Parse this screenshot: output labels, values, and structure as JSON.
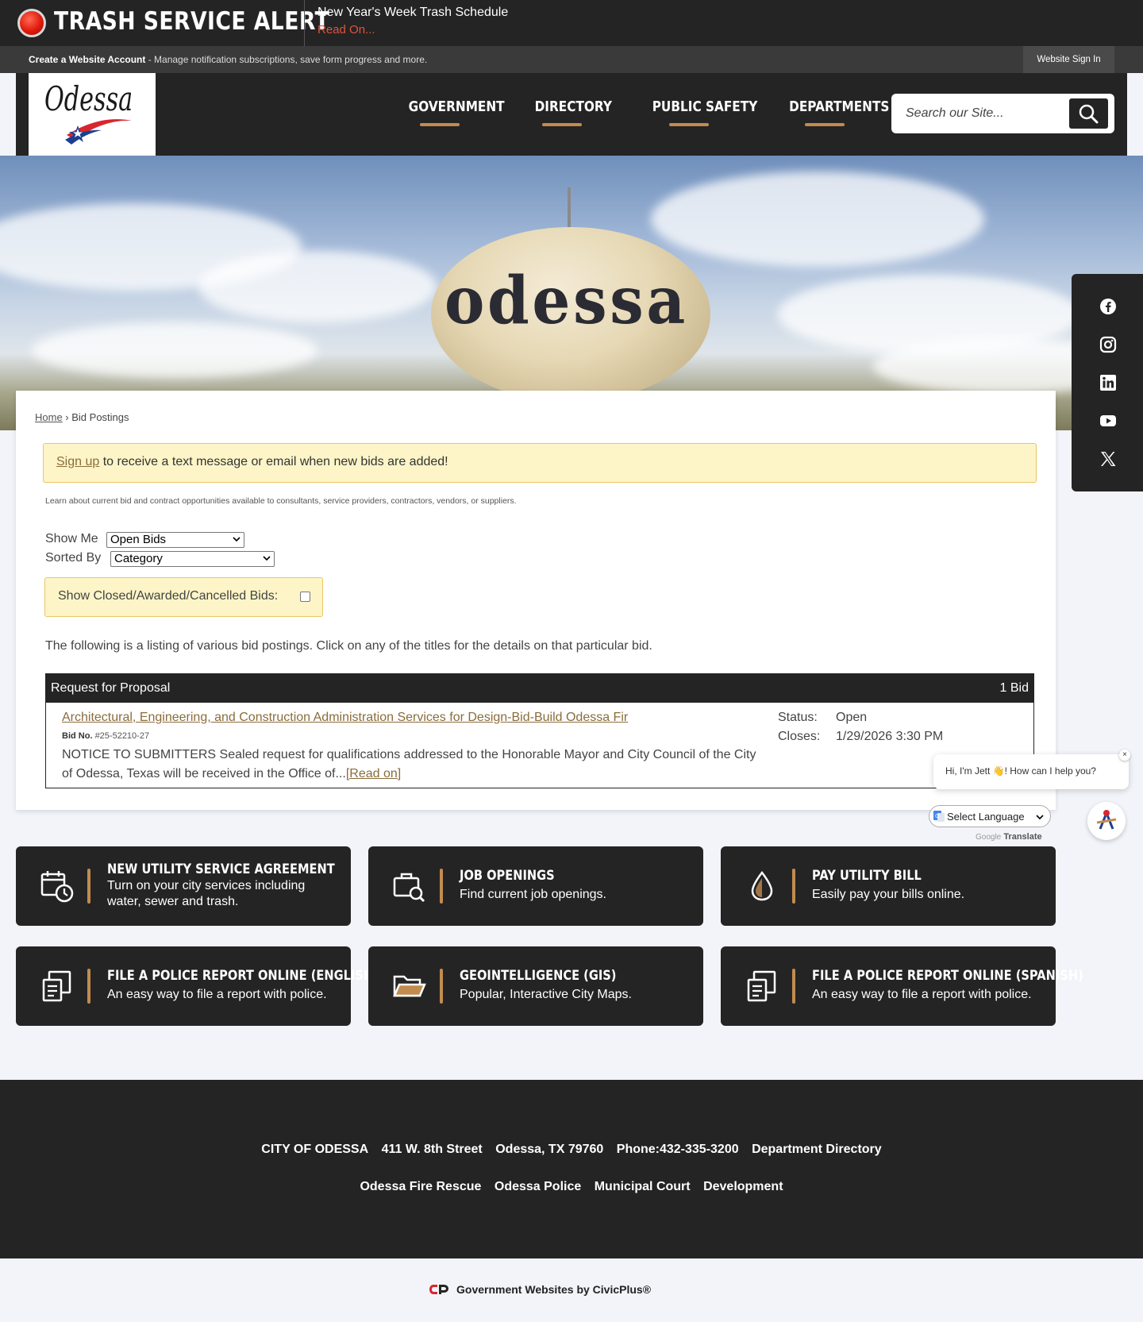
{
  "alert": {
    "title": "TRASH SERVICE ALERT",
    "message": "New Year's Week Trash Schedule",
    "read_on": "Read On..."
  },
  "account_bar": {
    "create_label": "Create a Website Account",
    "create_desc": " - Manage notification subscriptions, save form progress and more.",
    "sign_in": "Website Sign In"
  },
  "header": {
    "logo_text": "Odessa",
    "nav": [
      "GOVERNMENT",
      "DIRECTORY",
      "PUBLIC SAFETY",
      "DEPARTMENTS"
    ],
    "search_placeholder": "Search our Site..."
  },
  "hero": {
    "tower_text": "odessa"
  },
  "breadcrumb": {
    "home": "Home",
    "separator": " › ",
    "current": "Bid Postings"
  },
  "notice": {
    "link": "Sign up",
    "text": " to receive a text message or email when new bids are added!"
  },
  "intro": "Learn about current bid and contract opportunities available to consultants, service providers, contractors, vendors, or suppliers.",
  "filters": {
    "show_me_label": "Show Me",
    "show_me_value": "Open Bids",
    "sorted_by_label": "Sorted By",
    "sorted_by_value": "Category",
    "closed_label": "Show Closed/Awarded/Cancelled Bids:",
    "closed_checked": false
  },
  "listing_text": "The following is a listing of various bid postings. Click on any of the titles for the details on that particular bid.",
  "bids": {
    "category": "Request for Proposal",
    "count": "1 Bid",
    "items": [
      {
        "title": "Architectural, Engineering, and Construction Administration Services for Design-Bid-Build Odessa Fir",
        "bid_no_label": "Bid No.",
        "bid_no": "#25-52210-27",
        "description": "NOTICE TO SUBMITTERS Sealed request for qualifications addressed to the Honorable Mayor and City Council of the City of Odessa, Texas will be received in the Office of...",
        "read_on": "[Read on]",
        "status_label": "Status:",
        "status": "Open",
        "closes_label": "Closes:",
        "closes": "1/29/2026 3:30 PM"
      }
    ]
  },
  "chat": {
    "greeting": "Hi, I'm Jett 👋! How can I help you?",
    "close": "×"
  },
  "translate": {
    "select_label": "Select Language",
    "credit_google": "Google",
    "credit_translate": "Translate"
  },
  "quick_links": [
    {
      "title": "NEW UTILITY SERVICE AGREEMENT",
      "desc": "Turn on your city services including water, sewer and trash.",
      "icon": "calendar-clock-icon"
    },
    {
      "title": "JOB OPENINGS",
      "desc": "Find current job openings.",
      "icon": "briefcase-search-icon"
    },
    {
      "title": "PAY UTILITY BILL",
      "desc": "Easily pay your bills online.",
      "icon": "water-drop-icon"
    },
    {
      "title": "FILE A POLICE REPORT ONLINE (ENGLISH)",
      "desc": "An easy way to file a report with police.",
      "icon": "report-document-icon"
    },
    {
      "title": "GEOINTELLIGENCE (GIS)",
      "desc": "Popular, Interactive City Maps.",
      "icon": "folder-open-icon"
    },
    {
      "title": "FILE A POLICE REPORT ONLINE (SPANISH)",
      "desc": "An easy way to file a report with police.",
      "icon": "report-document-icon"
    }
  ],
  "footer": {
    "row1": [
      "CITY OF ODESSA",
      "411 W. 8th Street",
      "Odessa, TX 79760",
      "Phone:432-335-3200",
      "Department Directory"
    ],
    "row2": [
      "Odessa Fire Rescue",
      "Odessa Police",
      "Municipal Court",
      "Development"
    ],
    "credit": "Government Websites by CivicPlus®"
  },
  "colors": {
    "dark": "#242424",
    "accent": "#c28b4f",
    "notice_bg": "#fdf5c7",
    "alert_red": "#e0533e"
  }
}
